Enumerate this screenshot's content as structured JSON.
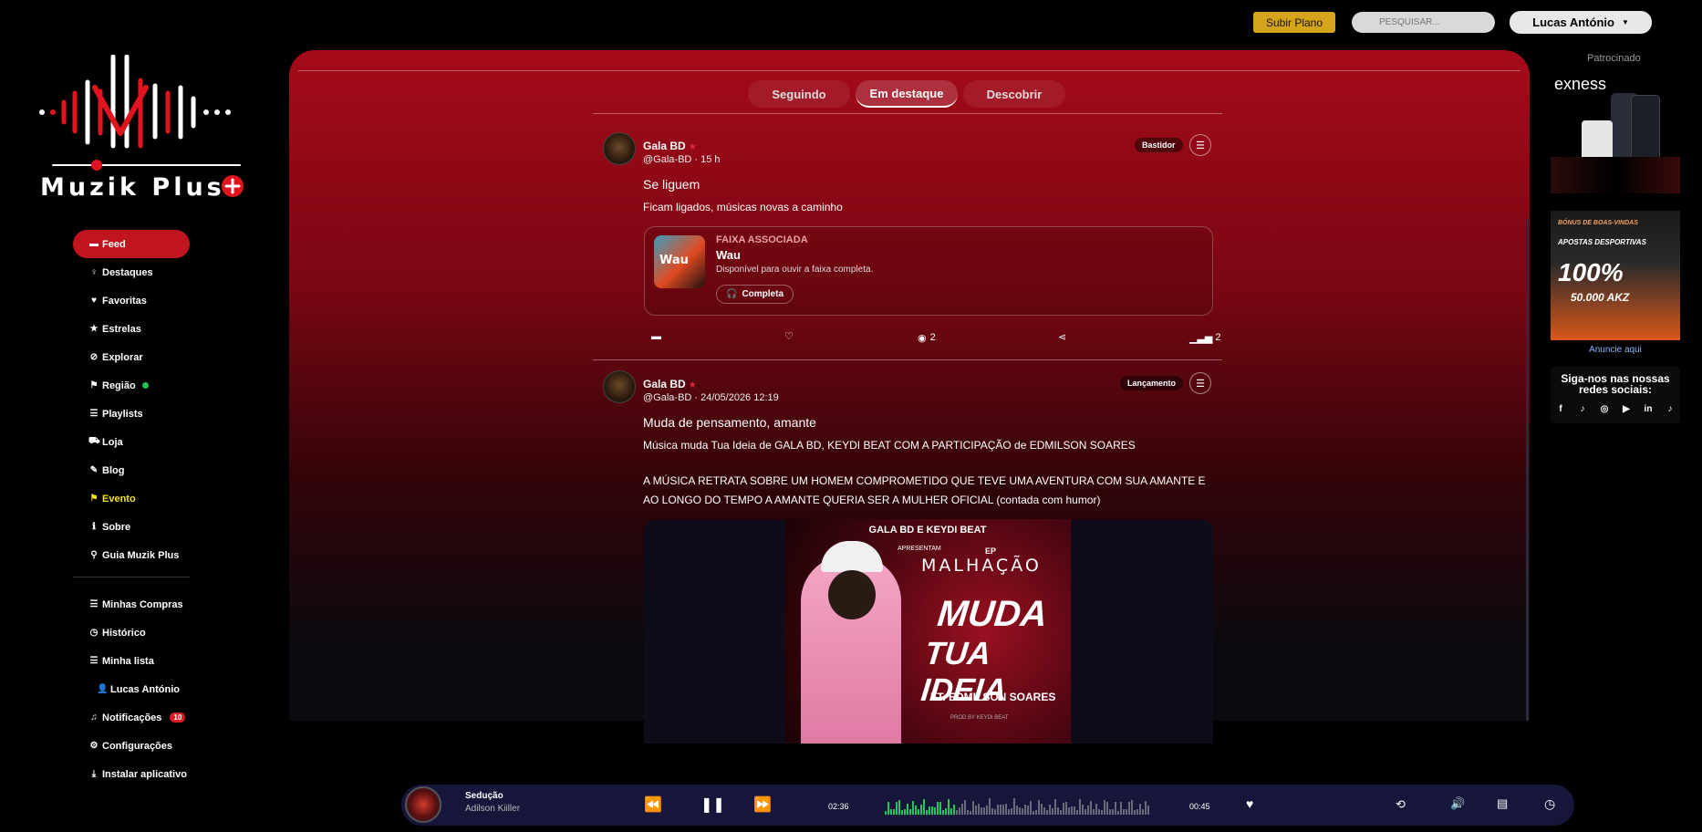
{
  "topbar": {
    "plan_button": "Subir Plano",
    "search_placeholder": "PESQUISAR...",
    "user_name": "Lucas António"
  },
  "brand": {
    "name": "Muzik Plus",
    "accent": "#e0131f"
  },
  "sidebar": {
    "items": [
      {
        "label": "Feed",
        "icon": "chat-icon"
      },
      {
        "label": "Destaques",
        "icon": "bulb-icon"
      },
      {
        "label": "Favoritas",
        "icon": "heart-icon"
      },
      {
        "label": "Estrelas",
        "icon": "star-icon"
      },
      {
        "label": "Explorar",
        "icon": "compass-icon"
      },
      {
        "label": "Região",
        "icon": "flag-icon"
      },
      {
        "label": "Playlists",
        "icon": "list-icon"
      },
      {
        "label": "Loja",
        "icon": "cart-icon"
      },
      {
        "label": "Blog",
        "icon": "blog-icon"
      },
      {
        "label": "Evento",
        "icon": "flag-icon"
      },
      {
        "label": "Sobre",
        "icon": "info-icon"
      },
      {
        "label": "Guia Muzik Plus",
        "icon": "guide-icon"
      }
    ],
    "items2": [
      {
        "label": "Minhas Compras",
        "icon": "list-icon"
      },
      {
        "label": "Histórico",
        "icon": "clock-icon"
      },
      {
        "label": "Minha lista",
        "icon": "list-icon"
      },
      {
        "label": "Lucas António",
        "icon": "user-icon"
      },
      {
        "label": "Notificações",
        "icon": "bell-icon",
        "badge": "10"
      },
      {
        "label": "Configurações",
        "icon": "gear-icon"
      },
      {
        "label": "Instalar aplicativo",
        "icon": "download-icon"
      }
    ]
  },
  "tabs": [
    "Seguindo",
    "Em destaque",
    "Descobrir"
  ],
  "posts": [
    {
      "name": "Gala BD",
      "meta": "@Gala-BD · 15 h",
      "badge": "Bastidor",
      "title": "Se liguem",
      "text": "Ficam ligados,  músicas novas a caminho",
      "track": {
        "label": "FAIXA ASSOCIADA",
        "title": "Wau",
        "desc": "Disponível para ouvir a faixa completa.",
        "button": "Completa"
      },
      "views": "2",
      "stats": "2"
    },
    {
      "name": "Gala BD",
      "meta": "@Gala-BD · 24/05/2026 12:19",
      "badge": "Lançamento",
      "title": "Muda de pensamento, amante",
      "text1": "Música muda Tua Ideia de GALA BD, KEYDI BEAT COM A PARTICIPAÇÃO de EDMILSON SOARES",
      "text2": "A MÚSICA RETRATA SOBRE UM HOMEM COMPROMETIDO QUE TEVE UMA AVENTURA COM SUA AMANTE E AO LONGO DO TEMPO A AMANTE QUERIA SER A MULHER OFICIAL (contada com humor)",
      "poster": {
        "line1": "GALA BD E KEYDI BEAT",
        "line2": "APRESENTAM",
        "ep": "EP",
        "album": "MALHAÇÃO",
        "song1": "MUDA",
        "song2": "TUA IDEIA",
        "feat": "FT. EDMILSON SOARES",
        "prod": "PROD BY KEYDI BEAT"
      }
    }
  ],
  "right": {
    "sponsor_label": "Patrocinado",
    "ad1_brand": "exness",
    "ad2_text1": "BÓNUS DE BOAS-VINDAS",
    "ad2_text2": "APOSTAS DESPORTIVAS",
    "ad2_pct": "100%",
    "ad2_amount": "50.000 AKZ",
    "ad_link": "Anuncie aqui",
    "social_title": "Siga-nos nas nossas redes sociais:"
  },
  "player": {
    "title": "Sedução",
    "artist": "Adilson Kiiller",
    "elapsed": "02:36",
    "remaining": "00:45",
    "progress": 0.27
  }
}
